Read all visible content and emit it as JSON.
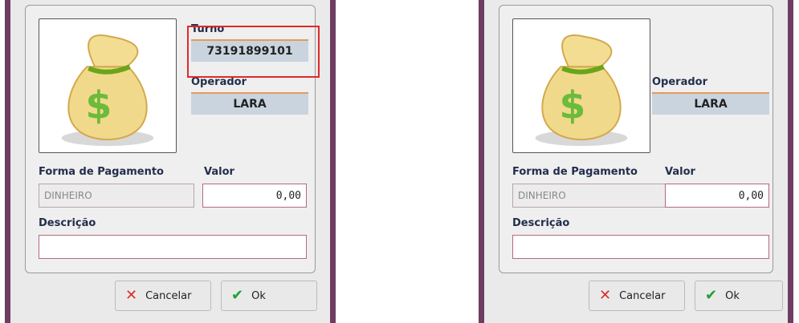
{
  "dialogs": [
    {
      "turno_label": "Turno",
      "turno_value": "73191899101",
      "operador_label": "Operador",
      "operador_value": "LARA",
      "forma_label": "Forma de Pagamento",
      "forma_value": "DINHEIRO",
      "valor_label": "Valor",
      "valor_value": "0,00",
      "descricao_label": "Descrição",
      "descricao_value": "",
      "cancel_label": "Cancelar",
      "ok_label": "Ok"
    },
    {
      "operador_label": "Operador",
      "operador_value": "LARA",
      "forma_label": "Forma de Pagamento",
      "forma_value": "DINHEIRO",
      "valor_label": "Valor",
      "valor_value": "0,00",
      "descricao_label": "Descrição",
      "descricao_value": "",
      "cancel_label": "Cancelar",
      "ok_label": "Ok"
    }
  ],
  "icons": {
    "money_bag": "money-bag-icon",
    "cancel": "close-icon",
    "ok": "check-icon"
  },
  "colors": {
    "frame": "#6e3d62",
    "readonly_bg": "#c9d4df",
    "accent_line": "#e79a5a",
    "highlight": "#e12a2a"
  }
}
